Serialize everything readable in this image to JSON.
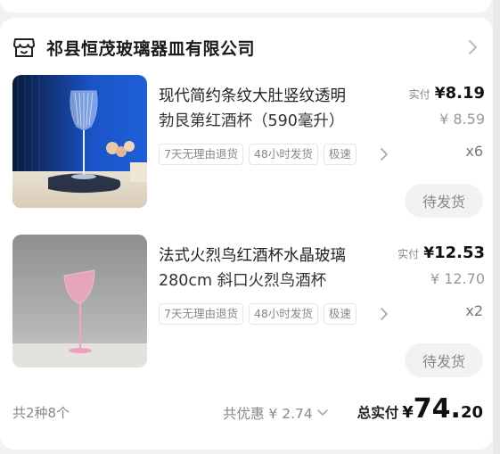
{
  "shop": {
    "name": "祁县恒茂玻璃器皿有限公司"
  },
  "items": [
    {
      "title_line1": "现代简约条纹大肚竖纹透明",
      "title_line2": "勃艮第红酒杯（590毫升）",
      "paid_label": "实付",
      "currency": "¥",
      "price": "8.19",
      "original_price": "¥ 8.59",
      "tags": [
        "7天无理由退货",
        "48小时发货",
        "极速"
      ],
      "quantity": "x6",
      "status": "待发货"
    },
    {
      "title_line1": "法式火烈鸟红酒杯水晶玻璃",
      "title_line2": "280cm 斜口火烈鸟酒杯",
      "paid_label": "实付",
      "currency": "¥",
      "price": "12.53",
      "original_price": "¥ 12.70",
      "tags": [
        "7天无理由退货",
        "48小时发货",
        "极速"
      ],
      "quantity": "x2",
      "status": "待发货"
    }
  ],
  "footer": {
    "count": "共2种8个",
    "discount": "共优惠 ¥ 2.74",
    "total_label": "总实付",
    "total_currency": "¥",
    "total_int": "74.",
    "total_dec": "20"
  }
}
